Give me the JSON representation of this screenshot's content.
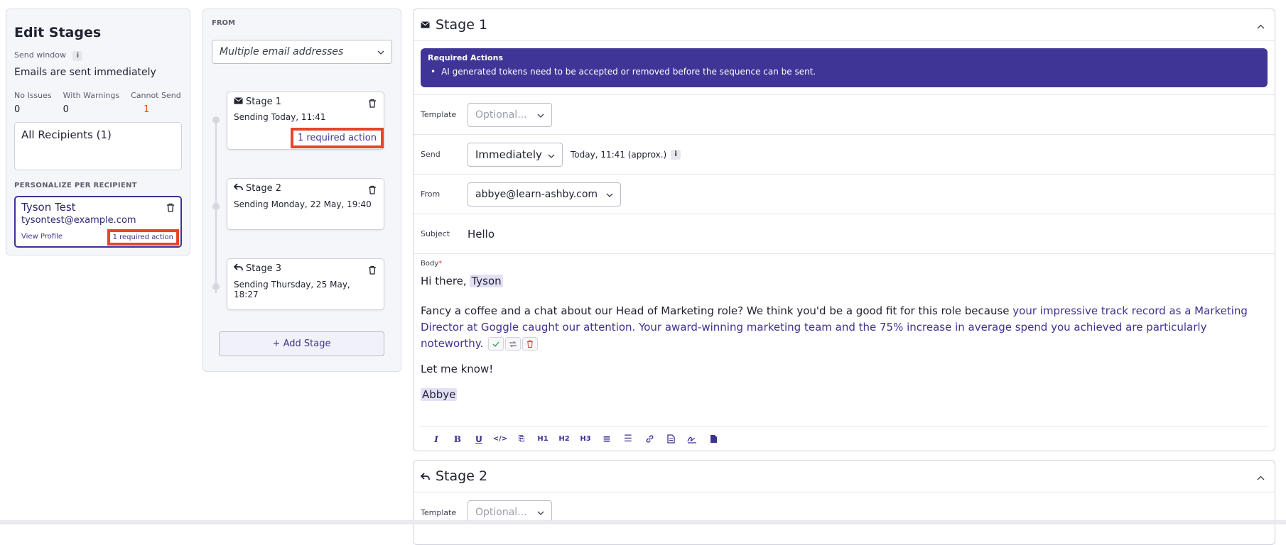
{
  "left": {
    "title": "Edit Stages",
    "send_window_label": "Send window",
    "info_glyph": "i",
    "send_window_value": "Emails are sent immediately",
    "stats": [
      {
        "label": "No Issues",
        "value": "0"
      },
      {
        "label": "With Warnings",
        "value": "0"
      },
      {
        "label": "Cannot Send",
        "value": "1"
      }
    ],
    "all_recipients": "All Recipients (1)",
    "personalize_label": "PERSONALIZE PER RECIPIENT",
    "recipient": {
      "name": "Tyson Test",
      "email": "tysontest@example.com",
      "view_profile": "View Profile",
      "required_action": "1 required action"
    }
  },
  "middle": {
    "from_label": "FROM",
    "from_select": "Multiple email addresses",
    "stages": [
      {
        "title": "Stage 1",
        "sub": "Sending Today, 11:41",
        "required_action": "1 required action",
        "icon": "envelope-icon"
      },
      {
        "title": "Stage 2",
        "sub": "Sending Monday, 22 May, 19:40",
        "icon": "reply-icon"
      },
      {
        "title": "Stage 3",
        "sub": "Sending Thursday, 25 May, 18:27",
        "icon": "reply-icon"
      }
    ],
    "add_stage": "+ Add Stage"
  },
  "stage1": {
    "title": "Stage 1",
    "required_title": "Required Actions",
    "required_item": "AI generated tokens need to be accepted or removed before the sequence can be sent.",
    "template_label": "Template",
    "template_placeholder": "Optional...",
    "send_label": "Send",
    "send_value": "Immediately",
    "send_time": "Today, 11:41 (approx.)",
    "from_label": "From",
    "from_value": "abbye@learn-ashby.com",
    "subject_label": "Subject",
    "subject_value": "Hello",
    "body_label": "Body",
    "body_required_mark": "*",
    "body": {
      "greeting": "Hi there,",
      "name_token": "Tyson",
      "para_start": "Fancy a coffee and a chat about our Head of Marketing role? We think you'd be a good fit for this role because ",
      "ai_text": "your impressive track record as a Marketing Director at Goggle caught our attention. Your award-winning marketing team and the 75% increase in average spend you achieved are particularly noteworthy.",
      "closing": "Let me know!",
      "signature_token": "Abbye"
    },
    "toolbar": [
      {
        "name": "italic-icon",
        "glyph": "I"
      },
      {
        "name": "bold-icon",
        "glyph": "B"
      },
      {
        "name": "underline-icon",
        "glyph": "U"
      },
      {
        "name": "code-icon",
        "glyph": "</>"
      },
      {
        "name": "code-block-icon",
        "glyph": "⎘"
      },
      {
        "name": "heading1-icon",
        "glyph": "H1"
      },
      {
        "name": "heading2-icon",
        "glyph": "H2"
      },
      {
        "name": "heading3-icon",
        "glyph": "H3"
      },
      {
        "name": "ordered-list-icon",
        "glyph": "≡"
      },
      {
        "name": "bullet-list-icon",
        "glyph": "☰"
      },
      {
        "name": "link-icon",
        "glyph": "🔗"
      },
      {
        "name": "file-icon",
        "glyph": "▤"
      },
      {
        "name": "signature-icon",
        "glyph": "✍"
      },
      {
        "name": "document-icon",
        "glyph": "▮"
      }
    ]
  },
  "stage2": {
    "title": "Stage 2",
    "template_label": "Template",
    "template_placeholder": "Optional..."
  },
  "colors": {
    "accent": "#3d3391",
    "required_bg": "#3f3596",
    "highlight": "#e8452c",
    "error": "#e8452c"
  }
}
